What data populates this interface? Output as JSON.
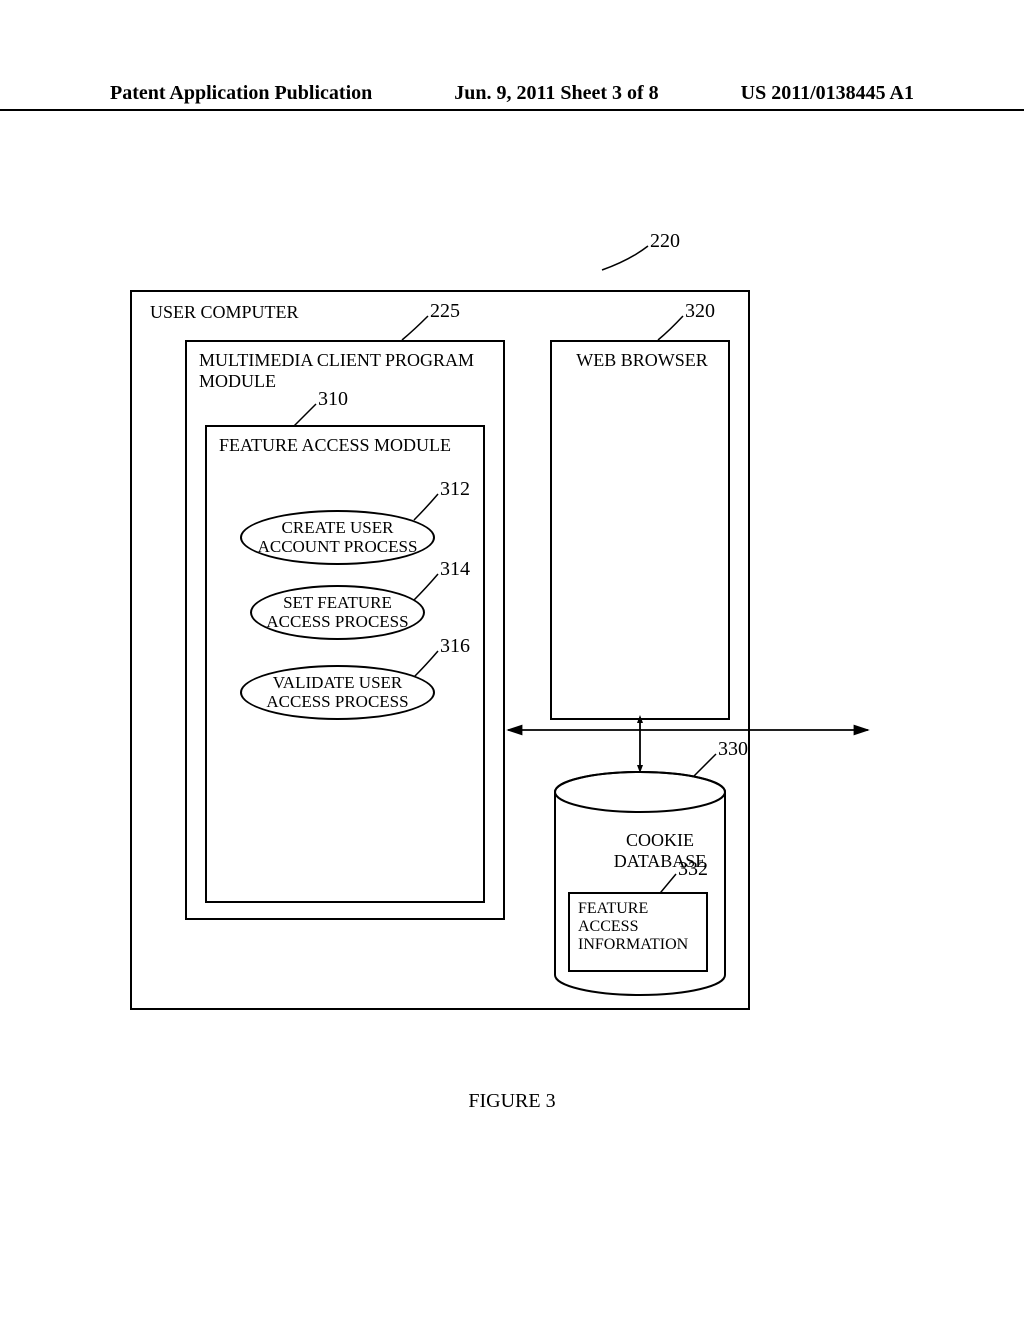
{
  "header": {
    "left": "Patent Application Publication",
    "mid": "Jun. 9, 2011   Sheet 3 of 8",
    "right": "US 2011/0138445 A1"
  },
  "diagram": {
    "user_computer": "USER COMPUTER",
    "multimedia_module": "MULTIMEDIA CLIENT PROGRAM\nMODULE",
    "feature_access_module": "FEATURE ACCESS MODULE",
    "process_create": "CREATE USER\nACCOUNT PROCESS",
    "process_set": "SET FEATURE\nACCESS PROCESS",
    "process_validate": "VALIDATE USER\nACCESS PROCESS",
    "web_browser": "WEB BROWSER",
    "cookie_db": "COOKIE\nDATABASE",
    "feature_info": "FEATURE\nACCESS\nINFORMATION"
  },
  "refs": {
    "r220": "220",
    "r225": "225",
    "r320": "320",
    "r310": "310",
    "r312": "312",
    "r314": "314",
    "r316": "316",
    "r330": "330",
    "r332": "332"
  },
  "caption": "FIGURE 3"
}
